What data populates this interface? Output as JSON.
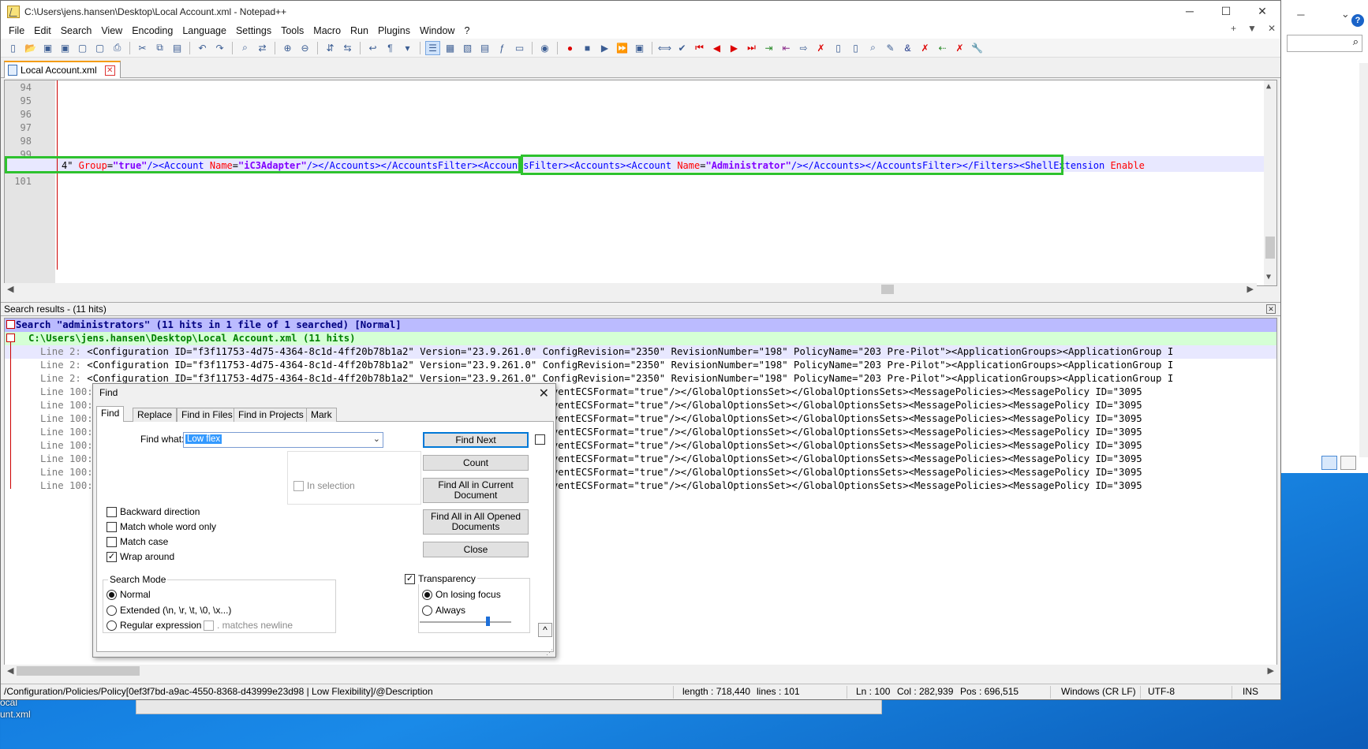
{
  "window": {
    "title": "C:\\Users\\jens.hansen\\Desktop\\Local Account.xml - Notepad++",
    "controls": {
      "minimize": "─",
      "maximize": "☐",
      "close": "✕"
    }
  },
  "menu": [
    "File",
    "Edit",
    "Search",
    "View",
    "Encoding",
    "Language",
    "Settings",
    "Tools",
    "Macro",
    "Run",
    "Plugins",
    "Window",
    "?"
  ],
  "menu_right": {
    "add": "+",
    "down": "▼",
    "close": "✕"
  },
  "tab": {
    "label": "Local Account.xml",
    "close": "✕"
  },
  "editor": {
    "line_numbers": [
      "94",
      "95",
      "96",
      "97",
      "98",
      "99",
      "100",
      "101"
    ],
    "line100": {
      "p1": "4\"",
      "a1": " Group",
      "e1": "=",
      "v1": "\"true\"",
      "t1": "/><Account",
      "a2": " Name",
      "e2": "=",
      "v2": "\"iC3Adapter\"",
      "t2": "/></Accounts></AccountsFilter>",
      "t3": "<AccountsFilter><Accounts><Account",
      "a3": " Name",
      "e3": "=",
      "v3": "\"Administrator\"",
      "t4": "/></Accounts></AccountsFilter>",
      "t5": "</Filters><ShellExtension",
      "a4": " Enable"
    }
  },
  "search_results": {
    "header": "Search results - (11 hits)",
    "summary": "Search \"administrators\" (11 hits in 1 file of 1 searched) [Normal]",
    "file": "C:\\Users\\jens.hansen\\Desktop\\Local Account.xml (11 hits)",
    "hits": [
      {
        "prefix": "Line    2:",
        "text": " <Configuration ID=\"f3f11753-4d75-4364-8c1d-4ff20b78b1a2\" Version=\"23.9.261.0\" ConfigRevision=\"2350\" RevisionNumber=\"198\" PolicyName=\"203 Pre-Pilot\"><ApplicationGroups><ApplicationGroup I"
      },
      {
        "prefix": "Line    2:",
        "text": " <Configuration ID=\"f3f11753-4d75-4364-8c1d-4ff20b78b1a2\" Version=\"23.9.261.0\" ConfigRevision=\"2350\" RevisionNumber=\"198\" PolicyName=\"203 Pre-Pilot\"><ApplicationGroups><ApplicationGroup I"
      },
      {
        "prefix": "Line    2:",
        "text": " <Configuration ID=\"f3f11753-4d75-4364-8c1d-4ff20b78b1a2\" Version=\"23.9.261.0\" ConfigRevision=\"2350\" RevisionNumber=\"198\" PolicyName=\"203 Pre-Pilot\"><ApplicationGroups><ApplicationGroup I"
      },
      {
        "prefix": "Line 100:",
        "text": "EnableRemoteEventECSFormat=\"true\"/></GlobalOptionsSet></GlobalOptionsSets><MessagePolicies><MessagePolicy ID=\"3095"
      },
      {
        "prefix": "Line 100:",
        "text": "EnableRemoteEventECSFormat=\"true\"/></GlobalOptionsSet></GlobalOptionsSets><MessagePolicies><MessagePolicy ID=\"3095"
      },
      {
        "prefix": "Line 100:",
        "text": "EnableRemoteEventECSFormat=\"true\"/></GlobalOptionsSet></GlobalOptionsSets><MessagePolicies><MessagePolicy ID=\"3095"
      },
      {
        "prefix": "Line 100:",
        "text": "EnableRemoteEventECSFormat=\"true\"/></GlobalOptionsSet></GlobalOptionsSets><MessagePolicies><MessagePolicy ID=\"3095"
      },
      {
        "prefix": "Line 100:",
        "text": "EnableRemoteEventECSFormat=\"true\"/></GlobalOptionsSet></GlobalOptionsSets><MessagePolicies><MessagePolicy ID=\"3095"
      },
      {
        "prefix": "Line 100:",
        "text": "EnableRemoteEventECSFormat=\"true\"/></GlobalOptionsSet></GlobalOptionsSets><MessagePolicies><MessagePolicy ID=\"3095"
      },
      {
        "prefix": "Line 100:",
        "text": "EnableRemoteEventECSFormat=\"true\"/></GlobalOptionsSet></GlobalOptionsSets><MessagePolicies><MessagePolicy ID=\"3095"
      },
      {
        "prefix": "Line 100:",
        "text": "EnableRemoteEventECSFormat=\"true\"/></GlobalOptionsSet></GlobalOptionsSets><MessagePolicies><MessagePolicy ID=\"3095"
      }
    ],
    "close": "✕"
  },
  "find_dialog": {
    "title": "Find",
    "close": "✕",
    "tabs": [
      "Find",
      "Replace",
      "Find in Files",
      "Find in Projects",
      "Mark"
    ],
    "find_what_label": "Find what:",
    "find_what_value": "Low flex",
    "buttons": {
      "find_next": "Find Next",
      "count": "Count",
      "find_all_current": "Find All in Current Document",
      "find_all_opened": "Find All in All Opened Documents",
      "close": "Close"
    },
    "in_selection": "In selection",
    "options": {
      "backward": "Backward direction",
      "whole_word": "Match whole word only",
      "match_case": "Match case",
      "wrap_around": "Wrap around",
      "wrap_around_checked": "✓"
    },
    "search_mode": {
      "label": "Search Mode",
      "normal": "Normal",
      "extended": "Extended (\\n, \\r, \\t, \\0, \\x...)",
      "regex": "Regular expression",
      "matches_newline": ". matches newline"
    },
    "transparency": {
      "label": "Transparency",
      "checked": "✓",
      "on_losing_focus": "On losing focus",
      "always": "Always",
      "level": 0.72
    },
    "collapse": "^"
  },
  "status_bar": {
    "path": "/Configuration/Policies/Policy[0ef3f7bd-a9ac-4550-8368-d43999e23d98 | Low Flexibility]/@Description",
    "length": "length : 718,440",
    "lines": "lines : 101",
    "ln": "Ln : 100",
    "col": "Col : 282,939",
    "pos": "Pos : 696,515",
    "eol": "Windows (CR LF)",
    "encoding": "UTF-8",
    "ins": "INS"
  },
  "desktop": {
    "icon_label": "ocal\nunt.xml"
  },
  "background_window": {
    "minimize": "─",
    "chevron": "⌄",
    "search_icon": "⌕",
    "help": "?"
  }
}
